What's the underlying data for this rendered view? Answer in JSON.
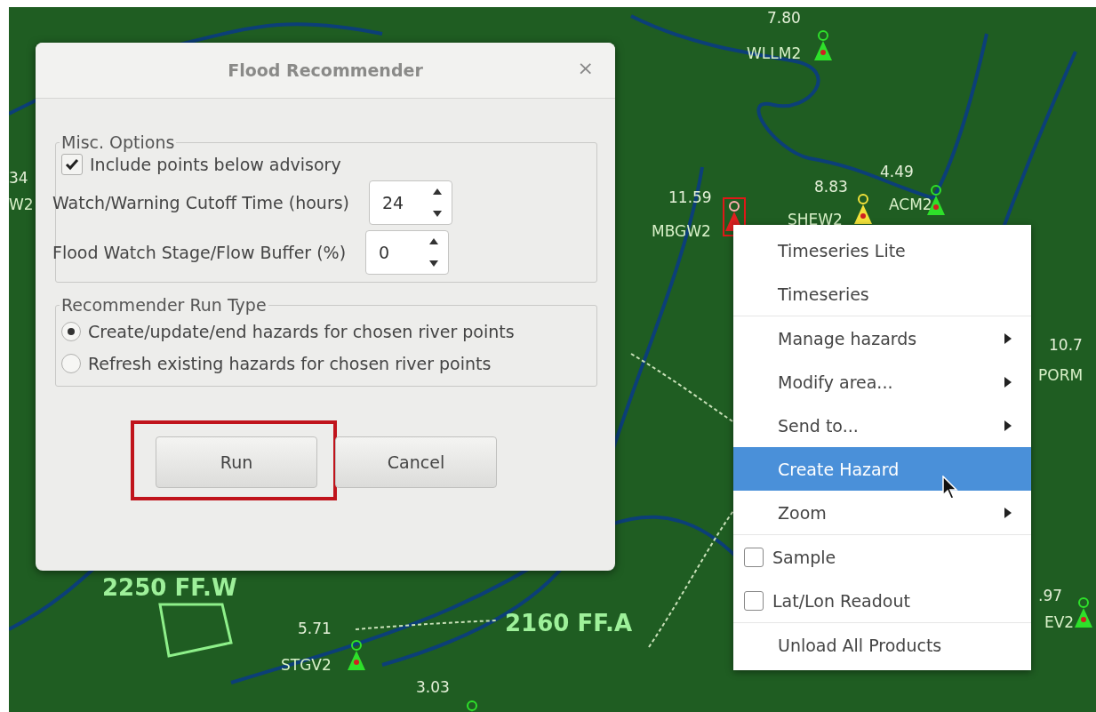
{
  "map": {
    "labels": [
      {
        "text": "7.80",
        "kind": "value"
      },
      {
        "text": "WLLM2",
        "kind": "station"
      },
      {
        "text": "11.59",
        "kind": "value"
      },
      {
        "text": "MBGW2",
        "kind": "station"
      },
      {
        "text": "8.83",
        "kind": "value"
      },
      {
        "text": "SHEW2",
        "kind": "station"
      },
      {
        "text": "4.49",
        "kind": "value"
      },
      {
        "text": "ACM2",
        "kind": "station"
      },
      {
        "text": "10.7",
        "kind": "value"
      },
      {
        "text": "PORM",
        "kind": "station"
      },
      {
        "text": "34",
        "kind": "value"
      },
      {
        "text": "W2",
        "kind": "station"
      },
      {
        "text": ".97",
        "kind": "value"
      },
      {
        "text": "EV2",
        "kind": "station"
      },
      {
        "text": "5.71",
        "kind": "value"
      },
      {
        "text": "STGV2",
        "kind": "station"
      },
      {
        "text": "3.03",
        "kind": "value"
      },
      {
        "text": "2250 FF.W",
        "kind": "hazard"
      },
      {
        "text": "2160 FF.A",
        "kind": "hazard"
      }
    ],
    "markers": [
      {
        "kind": "normal"
      },
      {
        "kind": "selected"
      },
      {
        "kind": "warning"
      },
      {
        "kind": "normal"
      },
      {
        "kind": "normal"
      },
      {
        "kind": "normal"
      },
      {
        "kind": "normal"
      }
    ]
  },
  "dialog": {
    "title": "Flood Recommender",
    "close": "×",
    "misc_options": {
      "title": "Misc. Options",
      "checkbox": {
        "label": "Include points below advisory",
        "checked": true
      },
      "spinners": [
        {
          "label": "Watch/Warning Cutoff Time (hours)",
          "value": "24"
        },
        {
          "label": "Flood Watch Stage/Flow Buffer (%)",
          "value": "0"
        }
      ]
    },
    "run_type": {
      "title": "Recommender Run Type",
      "options": [
        {
          "label": "Create/update/end hazards for chosen river points",
          "selected": true
        },
        {
          "label": "Refresh existing hazards for chosen river points",
          "selected": false
        }
      ]
    },
    "buttons": [
      {
        "label": "Run",
        "highlighted": true
      },
      {
        "label": "Cancel",
        "highlighted": false
      }
    ]
  },
  "context_menu": {
    "sections": [
      [
        {
          "label": "Timeseries Lite",
          "kind": "item",
          "selected": false
        },
        {
          "label": "Timeseries",
          "kind": "item",
          "selected": false
        }
      ],
      [
        {
          "label": "Manage hazards",
          "kind": "submenu",
          "selected": false
        },
        {
          "label": "Modify area...",
          "kind": "submenu",
          "selected": false
        },
        {
          "label": "Send to...",
          "kind": "submenu",
          "selected": false
        },
        {
          "label": "Create Hazard",
          "kind": "item",
          "selected": true
        },
        {
          "label": "Zoom",
          "kind": "submenu",
          "selected": false
        }
      ],
      [
        {
          "label": "Sample",
          "kind": "checkbox",
          "checked": false,
          "selected": false
        },
        {
          "label": "Lat/Lon Readout",
          "kind": "checkbox",
          "checked": false,
          "selected": false
        }
      ],
      [
        {
          "label": "Unload All Products",
          "kind": "item",
          "selected": false
        }
      ]
    ]
  }
}
